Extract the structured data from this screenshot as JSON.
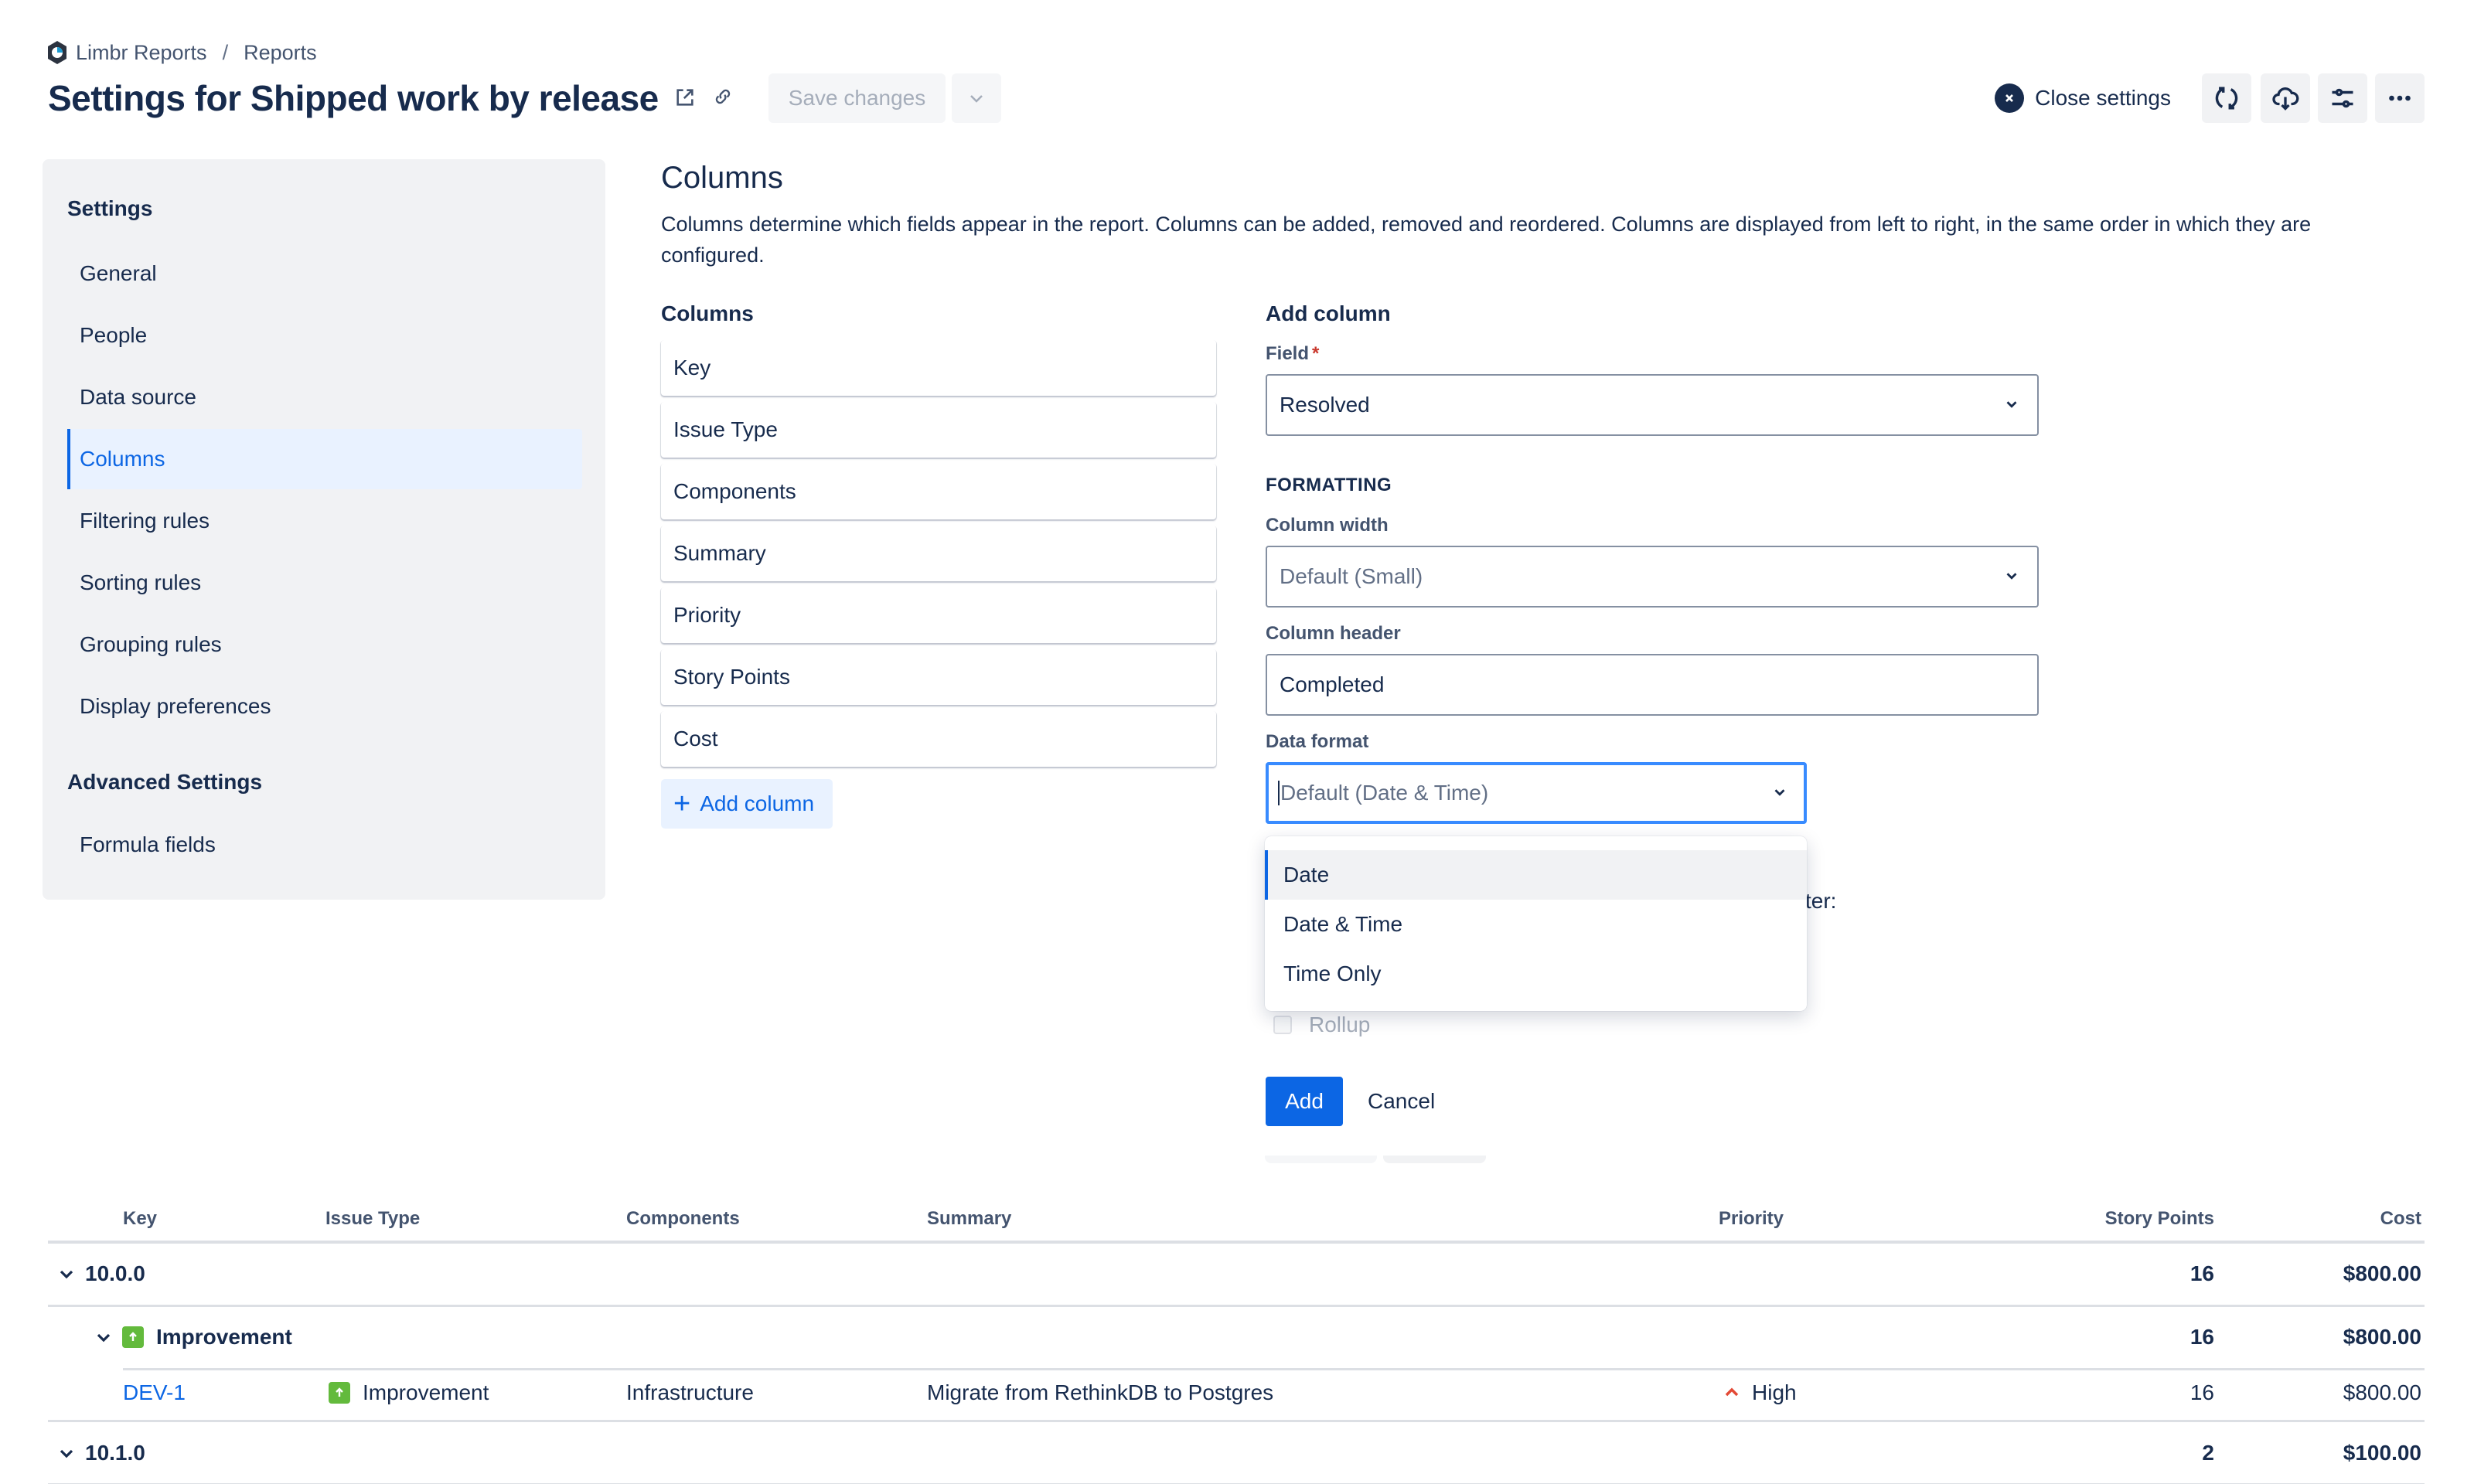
{
  "breadcrumb": {
    "app": "Limbr Reports",
    "separator": "/",
    "section": "Reports"
  },
  "header": {
    "title": "Settings for Shipped work by release",
    "save_label": "Save changes",
    "close_label": "Close settings",
    "icons": [
      "external-link-icon",
      "link-icon",
      "refresh-icon",
      "cloud-download-icon",
      "sliders-icon",
      "more-icon"
    ]
  },
  "sidebar": {
    "heading": "Settings",
    "items": [
      {
        "label": "General"
      },
      {
        "label": "People"
      },
      {
        "label": "Data source"
      },
      {
        "label": "Columns",
        "active": true
      },
      {
        "label": "Filtering rules"
      },
      {
        "label": "Sorting rules"
      },
      {
        "label": "Grouping rules"
      },
      {
        "label": "Display preferences"
      }
    ],
    "advanced_heading": "Advanced Settings",
    "advanced_items": [
      {
        "label": "Formula fields"
      }
    ]
  },
  "main": {
    "title": "Columns",
    "description": "Columns determine which fields appear in the report. Columns can be added, removed and reordered. Columns are displayed from left to right, in the same order in which they are configured.",
    "columns_label": "Columns",
    "columns": [
      "Key",
      "Issue Type",
      "Components",
      "Summary",
      "Priority",
      "Story Points",
      "Cost"
    ],
    "add_column_label": "Add column"
  },
  "form": {
    "heading": "Add column",
    "field_label": "Field",
    "field_required": "*",
    "field_value": "Resolved",
    "formatting_heading": "FORMATTING",
    "width_label": "Column width",
    "width_value": "Default (Small)",
    "header_label": "Column header",
    "header_value": "Completed",
    "format_label": "Data format",
    "format_placeholder": "Default (Date & Time)",
    "format_options": [
      "Date",
      "Date & Time",
      "Time Only"
    ],
    "format_highlighted": "Date",
    "behind_text": "ter:",
    "rollup_label": "Rollup",
    "rollup_checked": false,
    "add_label": "Add",
    "cancel_label": "Cancel"
  },
  "report": {
    "headers": [
      "Key",
      "Issue Type",
      "Components",
      "Summary",
      "Priority",
      "Story Points",
      "Cost"
    ],
    "groups": [
      {
        "label": "10.0.0",
        "story_points": "16",
        "cost": "$800.00",
        "subgroups": [
          {
            "label": "Improvement",
            "story_points": "16",
            "cost": "$800.00",
            "rows": [
              {
                "key": "DEV-1",
                "issue_type": "Improvement",
                "components": "Infrastructure",
                "summary": "Migrate from RethinkDB to Postgres",
                "priority": "High",
                "story_points": "16",
                "cost": "$800.00"
              }
            ]
          }
        ]
      },
      {
        "label": "10.1.0",
        "story_points": "2",
        "cost": "$100.00"
      }
    ]
  },
  "colors": {
    "accent": "#0c66e4",
    "text": "#172b4d",
    "improvement": "#63ba3c",
    "priority_high": "#e34935",
    "focus": "#388bff"
  }
}
